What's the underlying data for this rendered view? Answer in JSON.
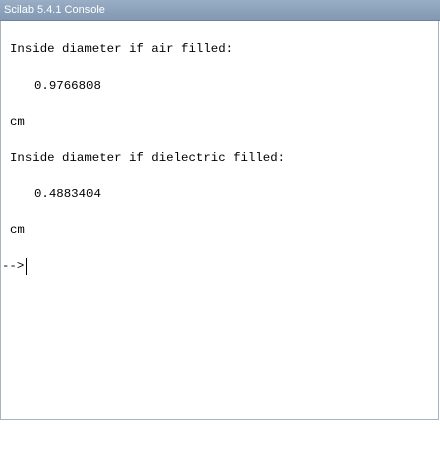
{
  "window": {
    "title": "Scilab 5.4.1 Console"
  },
  "console": {
    "lines": [
      "Inside diameter if air filled:",
      "0.9766808",
      "cm",
      "Inside diameter if dielectric filled:",
      "0.4883404",
      "cm"
    ],
    "prompt": "-->"
  }
}
